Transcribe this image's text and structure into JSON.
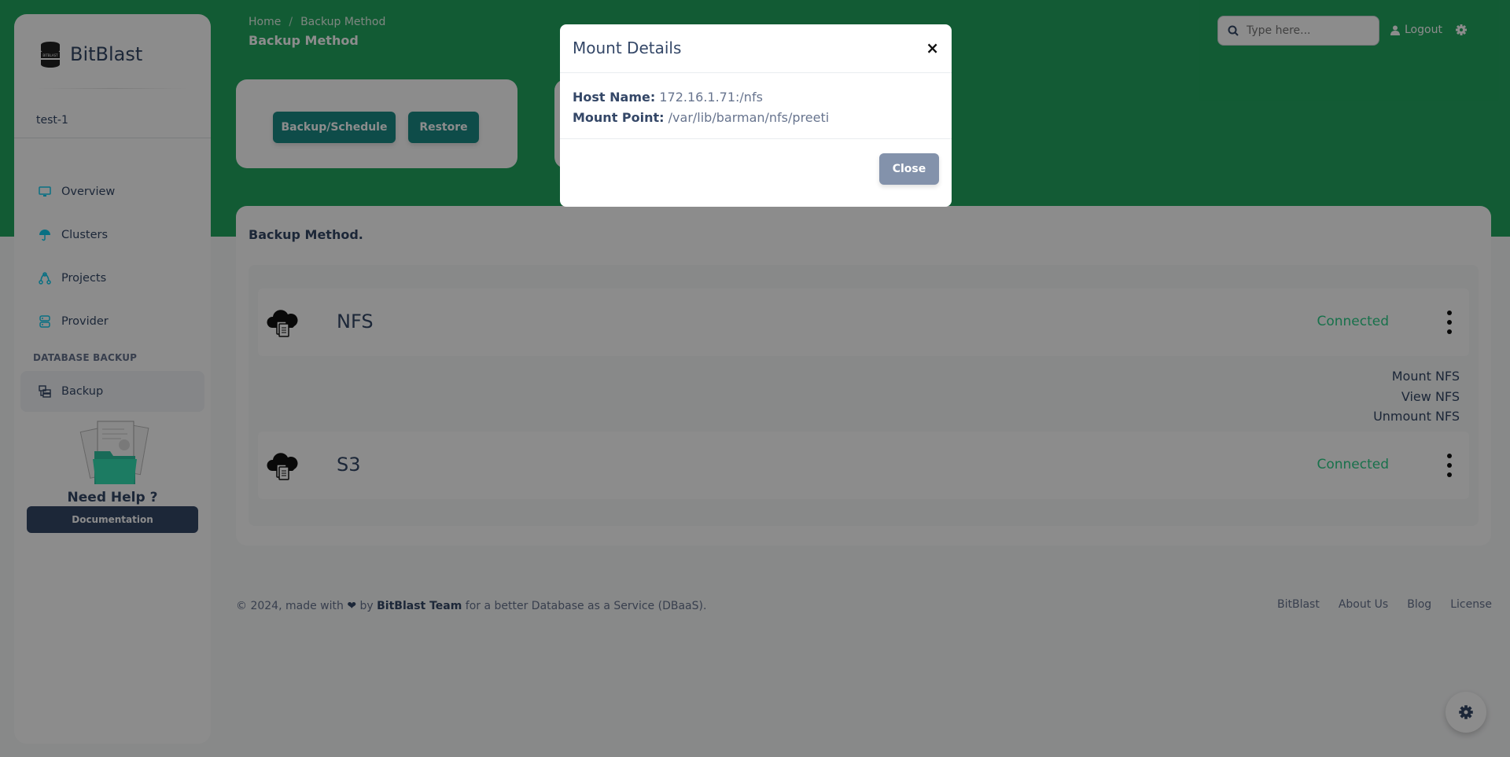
{
  "sidebar": {
    "brand": "BitBlast",
    "brand_logo_text": "BITBLAST",
    "user": "test-1",
    "items": [
      {
        "label": "Overview",
        "icon": "monitor-icon"
      },
      {
        "label": "Clusters",
        "icon": "umbrella-icon"
      },
      {
        "label": "Projects",
        "icon": "flow-icon"
      },
      {
        "label": "Provider",
        "icon": "server-icon"
      }
    ],
    "section_title": "DATABASE BACKUP",
    "backup_item": {
      "label": "Backup",
      "icon": "backup-icon"
    },
    "help_title": "Need Help ?",
    "doc_button": "Documentation"
  },
  "header": {
    "breadcrumb": [
      "Home",
      "/",
      "Backup Method"
    ],
    "title": "Backup Method",
    "search_placeholder": "Type here...",
    "logout": "Logout"
  },
  "actions": {
    "backup_button": "Backup/Schedule",
    "restore_button": "Restore"
  },
  "main": {
    "title": "Backup Method.",
    "methods": [
      {
        "name": "NFS",
        "status": "Connected"
      },
      {
        "name": "S3",
        "status": "Connected"
      }
    ],
    "dropdown": [
      "Mount NFS",
      "View NFS",
      "Unmount NFS"
    ]
  },
  "footer": {
    "copyright_prefix": "© 2024, made with",
    "by": "by",
    "team": "BitBlast Team",
    "suffix": "for a better Database as a Service (DBaaS).",
    "links": [
      "BitBlast",
      "About Us",
      "Blog",
      "License"
    ]
  },
  "modal": {
    "title": "Mount Details",
    "close_x": "×",
    "host_label": "Host Name:",
    "host_value": "172.16.1.71:/nfs",
    "mount_label": "Mount Point:",
    "mount_value": "/var/lib/barman/nfs/preeti",
    "close_button": "Close"
  },
  "colors": {
    "hero": "#22a660",
    "teal_button": "#1b8a86",
    "connected": "#2dce89",
    "dark_button": "#344767",
    "close_button": "#8392ab"
  }
}
